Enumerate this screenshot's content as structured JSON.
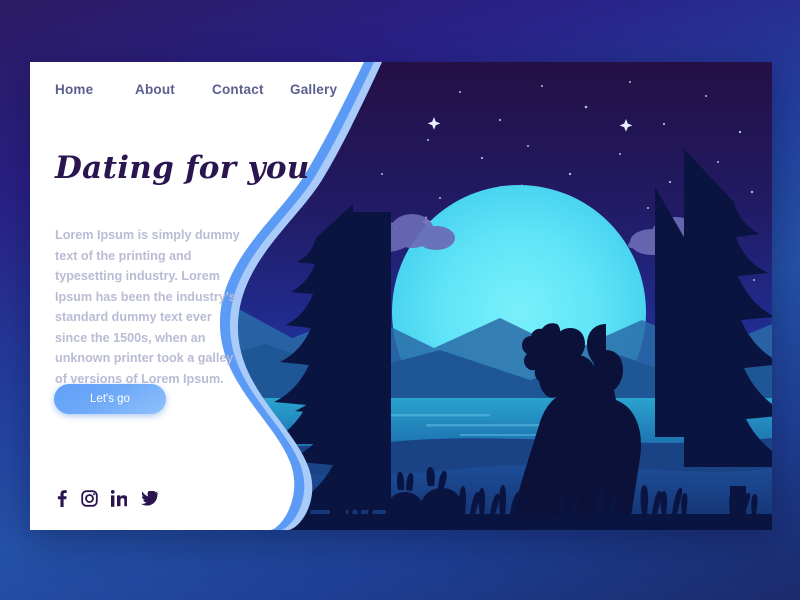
{
  "page": {
    "title": "Dating for you",
    "background_outer": "#2a2086",
    "card_background": "#ffffff"
  },
  "nav": {
    "items": [
      {
        "label": "Home",
        "name": "nav-home"
      },
      {
        "label": "About",
        "name": "nav-about"
      },
      {
        "label": "Contact",
        "name": "nav-contact"
      },
      {
        "label": "Gallery",
        "name": "nav-gallery"
      }
    ],
    "color": "#5b5f8e"
  },
  "hero": {
    "heading": "Dating for you",
    "heading_color": "#2a1550",
    "body": "Lorem Ipsum is simply dummy text of the printing and typesetting industry. Lorem Ipsum has been the industry's standard dummy text ever since the 1500s, when an unknown printer took a galley of versions of Lorem Ipsum.",
    "body_color": "#b9bcd4",
    "cta_label": "Let's go",
    "cta_color": "#6ea9f8"
  },
  "socials": {
    "items": [
      {
        "label": "Facebook",
        "name": "facebook-icon"
      },
      {
        "label": "Instagram",
        "name": "instagram-icon"
      },
      {
        "label": "LinkedIn",
        "name": "linkedin-icon"
      },
      {
        "label": "Twitter",
        "name": "twitter-icon"
      }
    ],
    "color": "#2a1550"
  },
  "illustration": {
    "scene": "night landscape with couple silhouette",
    "sky_top": "#231046",
    "sky_bottom": "#2336b4",
    "moon_color": "#55dff5",
    "mountain_colors": [
      "#2a6ba8",
      "#1f5796",
      "#17457f"
    ],
    "lake_color": "#1f8fc4",
    "tree_color": "#0a1440",
    "cloud_color": "#6b6bb5",
    "silhouette_color": "#0b1138",
    "wave_accent": "#5b9bf5",
    "wave_accent_light": "#9cc4f8",
    "elements": [
      "stars",
      "moon",
      "clouds",
      "mountains",
      "lake",
      "pine-trees",
      "grass",
      "rabbits",
      "couple"
    ]
  }
}
